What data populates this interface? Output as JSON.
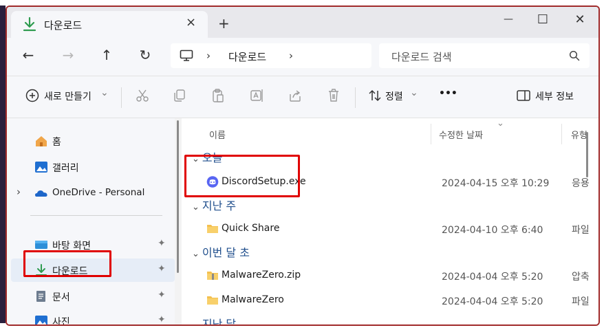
{
  "window": {
    "tab_title": "다운로드",
    "tab_close": "×",
    "new_tab": "+",
    "minimize": "—",
    "maximize": "☐",
    "close": "✕"
  },
  "nav": {
    "back": "←",
    "forward": "→",
    "up": "↑",
    "refresh": "↻",
    "breadcrumb_separator": "›",
    "breadcrumb": [
      "다운로드"
    ],
    "search_placeholder": "다운로드 검색"
  },
  "toolbar": {
    "new_label": "새로 만들기",
    "new_dropdown": "⌄",
    "sort_label": "정렬",
    "sort_dropdown": "⌄",
    "more_label": "•••",
    "details_label": "세부 정보"
  },
  "sidebar": {
    "items": [
      {
        "label": "홈",
        "icon": "home-icon"
      },
      {
        "label": "갤러리",
        "icon": "gallery-icon"
      },
      {
        "label": "OneDrive - Personal",
        "icon": "onedrive-icon",
        "expander": "›"
      },
      {
        "label": "바탕 화면",
        "icon": "desktop-icon",
        "pin": "📌"
      },
      {
        "label": "다운로드",
        "icon": "download-icon",
        "pin": "📌",
        "selected": true
      },
      {
        "label": "문서",
        "icon": "documents-icon",
        "pin": "📌"
      },
      {
        "label": "사진",
        "icon": "pictures-icon",
        "pin": "📌"
      }
    ]
  },
  "columns": {
    "name": "이름",
    "date": "수정한 날짜",
    "type": "유형",
    "sort_indicator": "⌄"
  },
  "groups": [
    {
      "label": "오늘",
      "chevron": "⌄"
    },
    {
      "label": "지난 주",
      "chevron": "⌄"
    },
    {
      "label": "이번 달 초",
      "chevron": "⌄"
    },
    {
      "label": "지난 달",
      "chevron": "⌄"
    }
  ],
  "files": [
    {
      "name": "DiscordSetup.exe",
      "date": "2024-04-15 오후 10:29",
      "type": "응용",
      "icon": "discord-icon"
    },
    {
      "name": "Quick Share",
      "date": "2024-04-10 오후 6:40",
      "type": "파일",
      "icon": "folder-icon"
    },
    {
      "name": "MalwareZero.zip",
      "date": "2024-04-04 오후 5:20",
      "type": "압축",
      "icon": "zip-folder-icon"
    },
    {
      "name": "MalwareZero",
      "date": "2024-04-04 오후 5:20",
      "type": "파일",
      "icon": "folder-icon"
    }
  ],
  "colors": {
    "accent": "#1f6fd1",
    "highlight_box": "#e00000",
    "selected_bg": "#e6edf7"
  }
}
